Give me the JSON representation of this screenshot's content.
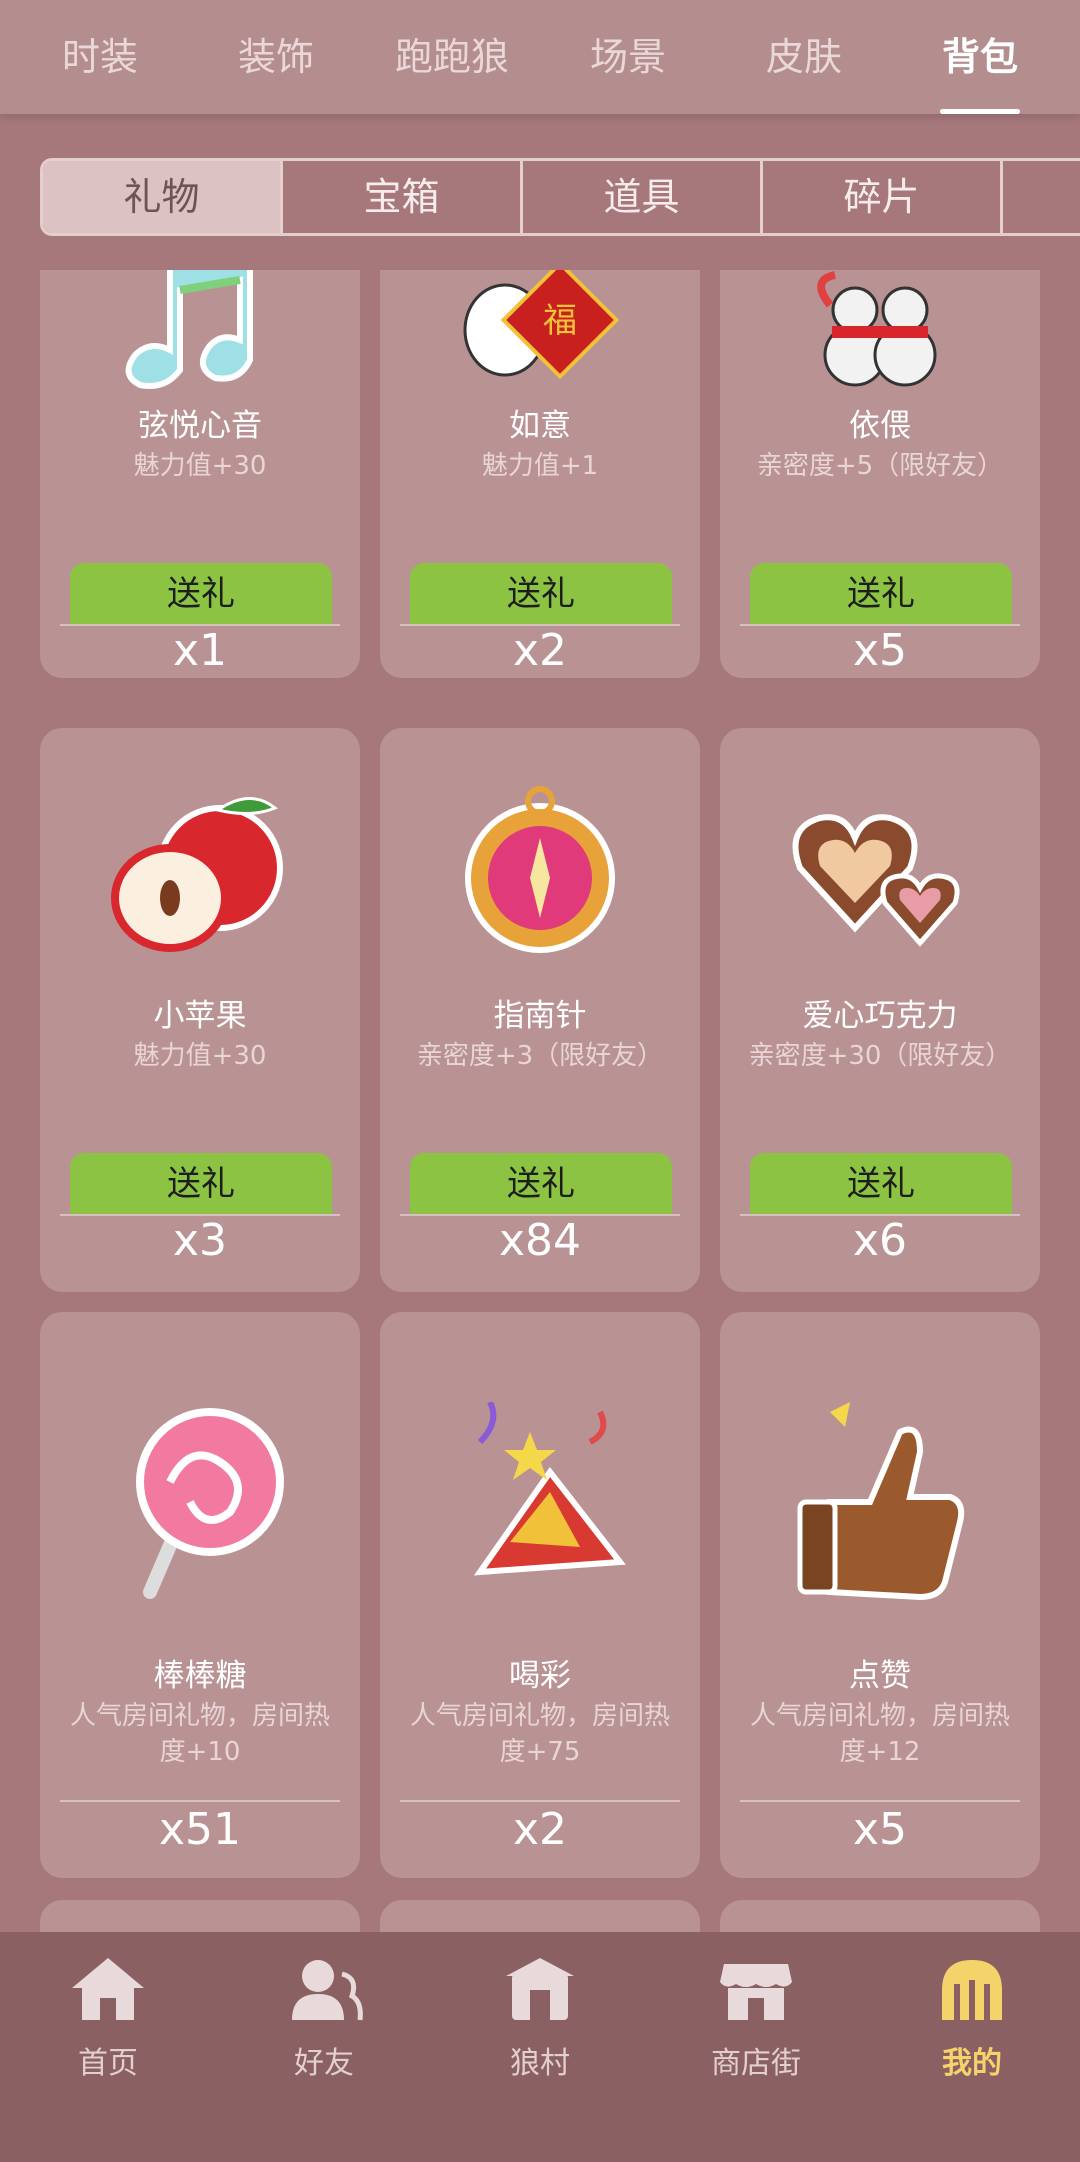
{
  "top_tabs": [
    "时装",
    "装饰",
    "跑跑狼",
    "场景",
    "皮肤",
    "背包"
  ],
  "top_tab_active": 5,
  "sub_tabs": [
    "礼物",
    "宝箱",
    "道具",
    "碎片"
  ],
  "sub_tab_active": 0,
  "send_label": "送礼",
  "items": [
    {
      "name": "弦悦心音",
      "desc": "魅力值+30",
      "count": "x1",
      "icon": "music-note-icon",
      "has_send": true
    },
    {
      "name": "如意",
      "desc": "魅力值+1",
      "count": "x2",
      "icon": "fortune-rabbit-icon",
      "has_send": true
    },
    {
      "name": "依偎",
      "desc": "亲密度+5（限好友）",
      "count": "x5",
      "icon": "snowmen-icon",
      "has_send": true
    },
    {
      "name": "小苹果",
      "desc": "魅力值+30",
      "count": "x3",
      "icon": "apple-icon",
      "has_send": true
    },
    {
      "name": "指南针",
      "desc": "亲密度+3（限好友）",
      "count": "x84",
      "icon": "compass-icon",
      "has_send": true
    },
    {
      "name": "爱心巧克力",
      "desc": "亲密度+30（限好友）",
      "count": "x6",
      "icon": "heart-chocolate-icon",
      "has_send": true
    },
    {
      "name": "棒棒糖",
      "desc": "人气房间礼物，房间热度+10",
      "count": "x51",
      "icon": "lollipop-icon",
      "has_send": false
    },
    {
      "name": "喝彩",
      "desc": "人气房间礼物，房间热度+75",
      "count": "x2",
      "icon": "party-popper-icon",
      "has_send": false
    },
    {
      "name": "点赞",
      "desc": "人气房间礼物，房间热度+12",
      "count": "x5",
      "icon": "thumbs-up-icon",
      "has_send": false
    }
  ],
  "bottom_nav": [
    {
      "label": "首页",
      "icon": "home-icon"
    },
    {
      "label": "好友",
      "icon": "friends-icon"
    },
    {
      "label": "狼村",
      "icon": "wolf-village-icon"
    },
    {
      "label": "商店街",
      "icon": "shop-street-icon"
    },
    {
      "label": "我的",
      "icon": "profile-icon"
    }
  ],
  "bottom_nav_active": 4,
  "colors": {
    "background": "#a6787c",
    "card": "#b99294",
    "send_button": "#8cc342",
    "nav_active": "#f5d36b"
  }
}
